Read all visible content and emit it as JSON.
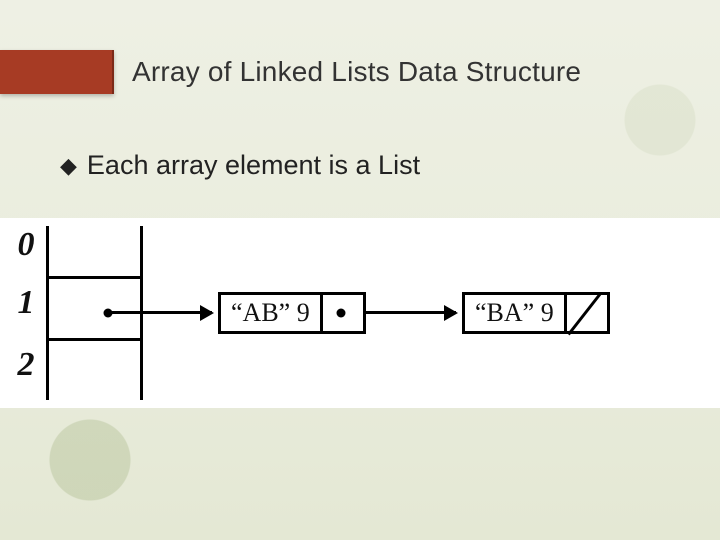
{
  "title": "Array of Linked Lists Data Structure",
  "bullet": {
    "glyph": "◆",
    "text": "Each array element is a List"
  },
  "array_indices": [
    "0",
    "1",
    "2"
  ],
  "list_at_index_1": {
    "nodes": [
      {
        "label": "“AB” 9",
        "next": "node"
      },
      {
        "label": "“BA” 9",
        "next": "null"
      }
    ]
  }
}
